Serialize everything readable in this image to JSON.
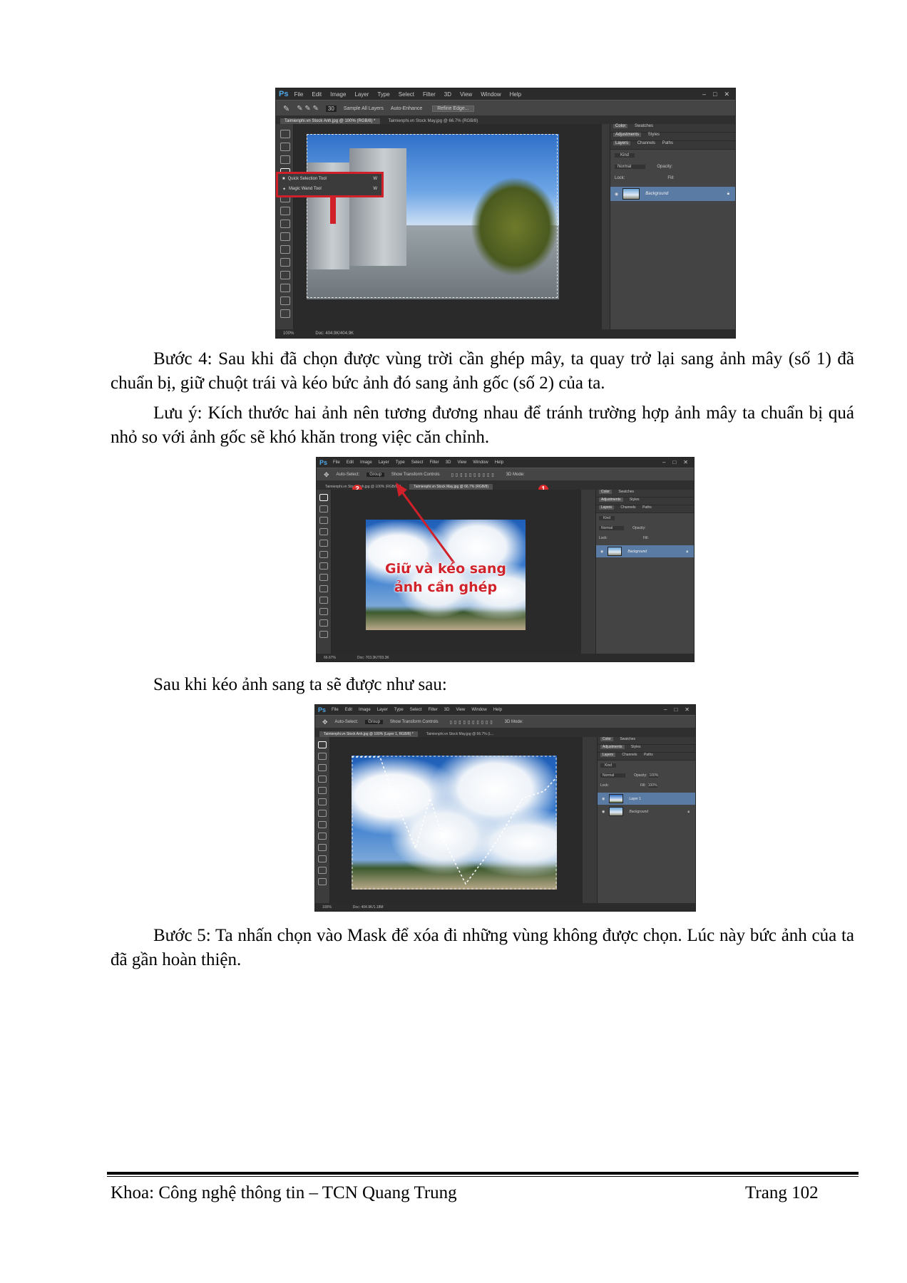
{
  "photoshop": {
    "logo": "Ps",
    "menu": [
      "File",
      "Edit",
      "Image",
      "Layer",
      "Type",
      "Select",
      "Filter",
      "3D",
      "View",
      "Window",
      "Help"
    ],
    "panel_tabs_top": [
      "Color",
      "Swatches"
    ],
    "panel_tabs_mid": [
      "Adjustments",
      "Styles"
    ],
    "panel_tabs_layers": [
      "Layers",
      "Channels",
      "Paths"
    ],
    "kind_label": "Kind",
    "blend_mode": "Normal",
    "opacity_label": "Opacity:",
    "opacity_value": "100%",
    "fill_label": "Fill:",
    "fill_value": "100%",
    "lock_label": "Lock:",
    "window_controls": [
      "–",
      "□",
      "✕"
    ]
  },
  "screenshot1": {
    "options": [
      "Sample All Layers",
      "Auto-Enhance"
    ],
    "refine_button": "Refine Edge...",
    "tabs": [
      "Taimienphi.vn Stock Anh.jpg @ 100% (RGB/8) *",
      "Taimienphi.vn Stock May.jpg @ 66.7% (RGB/8)"
    ],
    "flyout": [
      "Quick Selection Tool",
      "Magic Wand Tool"
    ],
    "flyout_key": "W",
    "layers": [
      {
        "name": "Background"
      }
    ],
    "status_zoom": "100%",
    "status_doc": "Doc: 404.9K/404.9K"
  },
  "screenshot2": {
    "options": [
      "Auto-Select:",
      "Group",
      "Show Transform Controls"
    ],
    "tabs": [
      "Taimienphi.vn Stock Anh.jpg @ 100% (RGB/8) *",
      "Taimienphi.vn Stock May.jpg @ 66.7% (RGB/8)"
    ],
    "badge_a": "2",
    "badge_b": "1",
    "overlay_line1": "Giữ và kéo sang",
    "overlay_line2": "ảnh cần ghép",
    "mode_3d": "3D Mode:",
    "layers": [
      {
        "name": "Background"
      }
    ],
    "status_zoom": "66.67%",
    "status_doc": "Doc: 703.3K/703.3K"
  },
  "screenshot3": {
    "options": [
      "Auto-Select:",
      "Group",
      "Show Transform Controls"
    ],
    "tabs": [
      "Taimienphi.vn Stock Anh.jpg @ 100% (Layer 1, RGB/8) *",
      "Taimienphi.vn Stock May.jpg @ 66.7% (L..."
    ],
    "mode_3d": "3D Mode:",
    "layers": [
      {
        "name": "Layer 1"
      },
      {
        "name": "Background"
      }
    ],
    "status_zoom": "100%",
    "status_doc": "Doc: 404.9K/1.18M"
  },
  "text": {
    "step4": "Bước 4: Sau khi đã chọn được vùng trời cần ghép mây, ta quay trở lại sang ảnh mây (số 1) đã chuẩn bị, giữ chuột trái và kéo bức ảnh đó sang ảnh gốc (số 2) của ta.",
    "note": "Lưu ý: Kích thước hai ảnh nên tương đương nhau để tránh trường hợp ảnh mây ta chuẩn bị quá nhỏ so với ảnh gốc sẽ khó khăn trong việc căn chỉnh.",
    "after_drag": "Sau khi kéo ảnh sang ta sẽ được như sau:",
    "step5": "Bước 5: Ta nhấn chọn vào Mask để xóa đi những vùng không được chọn. Lúc này bức ảnh của ta đã gần hoàn thiện."
  },
  "footer": {
    "left": "Khoa: Công nghệ thông tin – TCN Quang Trung",
    "right": "Trang 102"
  }
}
